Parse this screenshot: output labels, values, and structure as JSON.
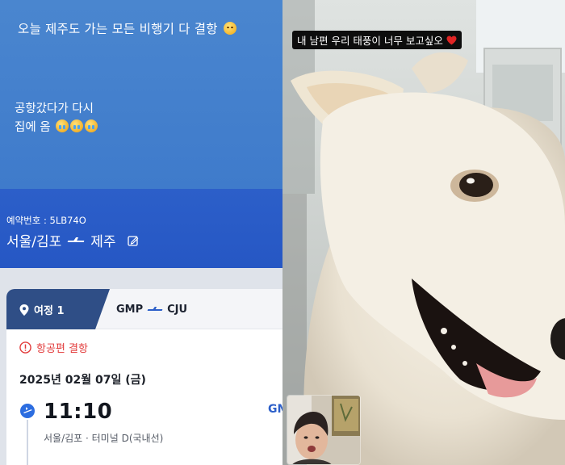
{
  "left_story": {
    "headline": "오늘 제주도 가는 모든 비행기 다 결항",
    "body_line1": "공항갔다가 다시",
    "body_line2": "집에 옴"
  },
  "booking": {
    "number_label": "예약번호 : 5LB74O",
    "origin": "서울/김포",
    "destination": "제주"
  },
  "itinerary": {
    "tab_label": "여정 1",
    "from_code": "GMP",
    "to_code": "CJU",
    "status": "항공편 결항",
    "date": "2025년 02월 07일 (금)",
    "departure_time": "11:10",
    "departure_terminal": "서울/김포 · 터미널 D(국내선)",
    "arrival_code_partial": "GM"
  },
  "right_story": {
    "caption": "내 남편 우리 태풍이 너무 보고싶오"
  },
  "colors": {
    "story_blue": "#3f7bcb",
    "booking_blue": "#2657c4",
    "tab_navy": "#2f4e86",
    "alert_red": "#e23b3b"
  },
  "icons": [
    "emoji-smiling-face",
    "emoji-crying-face",
    "plane-icon",
    "edit-icon",
    "pin-icon",
    "warning-icon",
    "departure-icon",
    "heart-icon"
  ]
}
